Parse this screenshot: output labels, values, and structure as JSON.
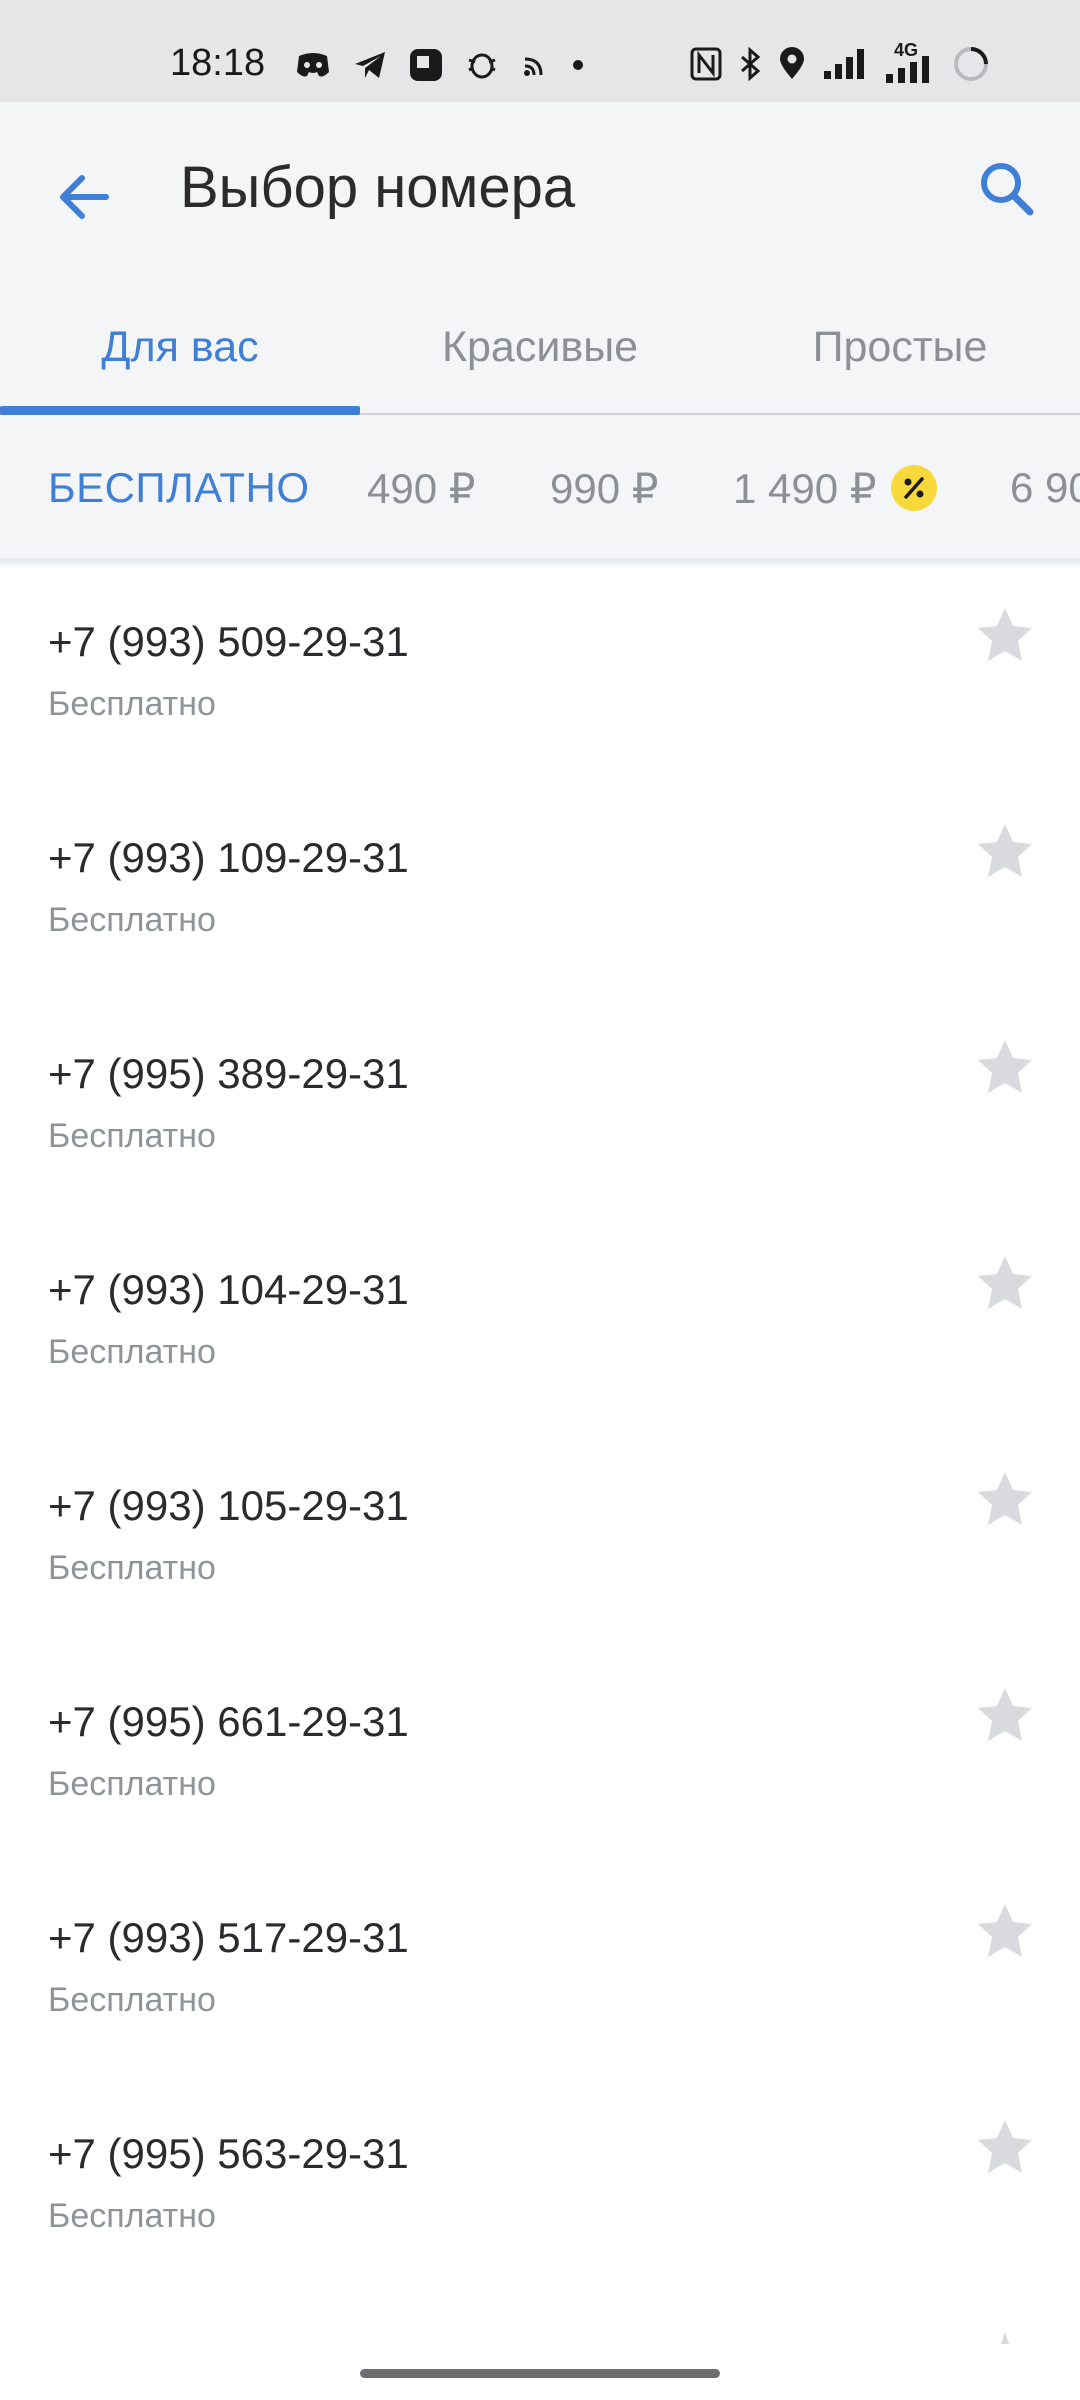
{
  "status_bar": {
    "time": "18:18",
    "left_icons": [
      "discord-icon",
      "telegram-icon",
      "app-icon",
      "bug-icon",
      "cast-icon",
      "dot-icon"
    ],
    "right_icons": [
      "nfc-icon",
      "bluetooth-icon",
      "location-icon",
      "signal-icon",
      "signal-4g-icon",
      "battery-loading-icon"
    ],
    "network_label": "4G"
  },
  "header": {
    "back_icon": "arrow-left-icon",
    "title": "Выбор номера",
    "search_icon": "search-icon"
  },
  "tabs": [
    {
      "label": "Для вас",
      "active": true
    },
    {
      "label": "Красивые",
      "active": false
    },
    {
      "label": "Простые",
      "active": false
    }
  ],
  "filters": [
    {
      "label": "БЕСПЛАТНО",
      "active": true
    },
    {
      "label": "490 ₽",
      "active": false
    },
    {
      "label": "990 ₽",
      "active": false
    },
    {
      "label": "1 490 ₽",
      "active": false,
      "badge": "%"
    },
    {
      "label": "6 90",
      "active": false
    }
  ],
  "numbers": [
    {
      "number": "+7 (993) 509-29-31",
      "price": "Бесплатно"
    },
    {
      "number": "+7 (993) 109-29-31",
      "price": "Бесплатно"
    },
    {
      "number": "+7 (995) 389-29-31",
      "price": "Бесплатно"
    },
    {
      "number": "+7 (993) 104-29-31",
      "price": "Бесплатно"
    },
    {
      "number": "+7 (993) 105-29-31",
      "price": "Бесплатно"
    },
    {
      "number": "+7 (995) 661-29-31",
      "price": "Бесплатно"
    },
    {
      "number": "+7 (993) 517-29-31",
      "price": "Бесплатно"
    },
    {
      "number": "+7 (995) 563-29-31",
      "price": "Бесплатно"
    }
  ],
  "colors": {
    "accent": "#3f7fd6",
    "discount_badge": "#f8d83a",
    "star": "#d9dadd"
  }
}
